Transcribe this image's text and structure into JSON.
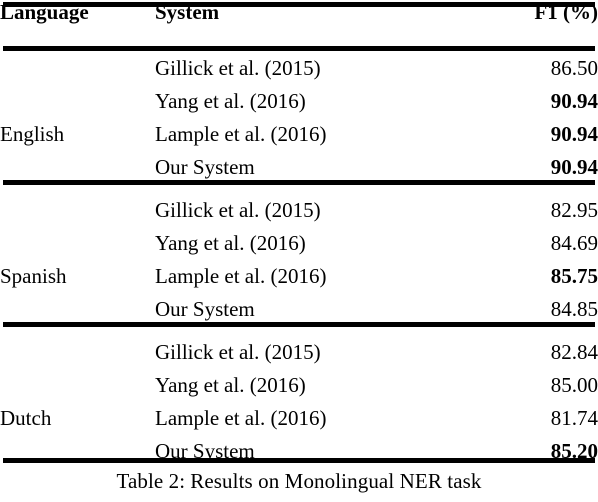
{
  "table": {
    "number_label": "Table 2:",
    "caption": "Results on Monolingual NER task",
    "caption_full": "Table 2: Results on Monolingual NER task",
    "columns": [
      {
        "key": "language",
        "header": "Language",
        "align": "left"
      },
      {
        "key": "system",
        "header": "System",
        "align": "left"
      },
      {
        "key": "f1",
        "header": "F1 (%)",
        "align": "right"
      }
    ],
    "blocks": [
      {
        "language": "English",
        "rows": [
          {
            "system": "Gillick et al. (2015)",
            "f1": "86.50",
            "bold": false
          },
          {
            "system": "Yang et al. (2016)",
            "f1": "90.94",
            "bold": true
          },
          {
            "system": "Lample et al. (2016)",
            "f1": "90.94",
            "bold": true
          },
          {
            "system": "Our System",
            "f1": "90.94",
            "bold": true
          }
        ]
      },
      {
        "language": "Spanish",
        "rows": [
          {
            "system": "Gillick et al. (2015)",
            "f1": "82.95",
            "bold": false
          },
          {
            "system": "Yang et al. (2016)",
            "f1": "84.69",
            "bold": false
          },
          {
            "system": "Lample et al. (2016)",
            "f1": "85.75",
            "bold": true
          },
          {
            "system": "Our System",
            "f1": "84.85",
            "bold": false
          }
        ]
      },
      {
        "language": "Dutch",
        "rows": [
          {
            "system": "Gillick et al. (2015)",
            "f1": "82.84",
            "bold": false
          },
          {
            "system": "Yang et al. (2016)",
            "f1": "85.00",
            "bold": false
          },
          {
            "system": "Lample et al. (2016)",
            "f1": "81.74",
            "bold": false
          },
          {
            "system": "Our System",
            "f1": "85.20",
            "bold": true
          }
        ]
      }
    ]
  },
  "chart_data": {
    "type": "table",
    "title": "Table 2: Results on Monolingual NER task",
    "columns": [
      "Language",
      "System",
      "F1 (%)"
    ],
    "rows": [
      [
        "English",
        "Gillick et al. (2015)",
        86.5
      ],
      [
        "English",
        "Yang et al. (2016)",
        90.94
      ],
      [
        "English",
        "Lample et al. (2016)",
        90.94
      ],
      [
        "English",
        "Our System",
        90.94
      ],
      [
        "Spanish",
        "Gillick et al. (2015)",
        82.95
      ],
      [
        "Spanish",
        "Yang et al. (2016)",
        84.69
      ],
      [
        "Spanish",
        "Lample et al. (2016)",
        85.75
      ],
      [
        "Spanish",
        "Our System",
        84.85
      ],
      [
        "Dutch",
        "Gillick et al. (2015)",
        82.84
      ],
      [
        "Dutch",
        "Yang et al. (2016)",
        85.0
      ],
      [
        "Dutch",
        "Lample et al. (2016)",
        81.74
      ],
      [
        "Dutch",
        "Our System",
        85.2
      ]
    ],
    "bold_cells": [
      [
        "English",
        "Yang et al. (2016)"
      ],
      [
        "English",
        "Lample et al. (2016)"
      ],
      [
        "English",
        "Our System"
      ],
      [
        "Spanish",
        "Lample et al. (2016)"
      ],
      [
        "Dutch",
        "Our System"
      ]
    ],
    "ylabel": "F1 (%)",
    "xlabel": "System"
  },
  "style": {
    "text_color": "#000000",
    "background_color": "#ffffff",
    "rule_color": "#000000"
  }
}
